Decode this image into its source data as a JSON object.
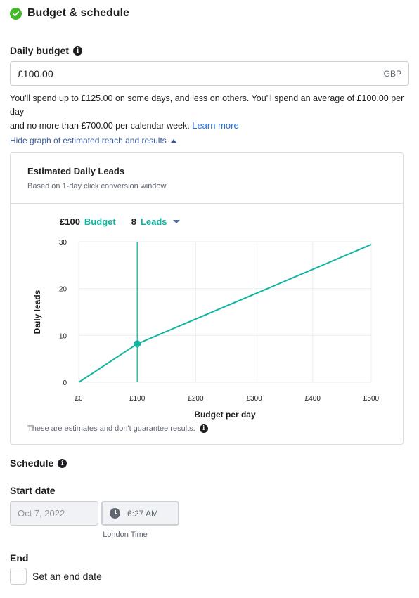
{
  "section": {
    "title": "Budget & schedule"
  },
  "budget": {
    "label": "Daily budget",
    "value": "£100.00",
    "currency": "GBP",
    "help_line1": "You'll spend up to £125.00 on some days, and less on others. You'll spend an average of £100.00 per day",
    "help_line2": "and no more than £700.00 per calendar week.",
    "learn_more": "Learn more"
  },
  "graph_toggle": {
    "label": "Hide graph of estimated reach and results"
  },
  "graph": {
    "title": "Estimated Daily Leads",
    "subtitle": "Based on 1-day click conversion window",
    "budget_stat": "£100",
    "budget_label": "Budget",
    "leads_stat": "8",
    "leads_label": "Leads",
    "disclaimer": "These are estimates and don't guarantee results."
  },
  "chart_data": {
    "type": "line",
    "xlabel": "Budget per day",
    "ylabel": "Daily leads",
    "x_ticks": [
      "£0",
      "£100",
      "£200",
      "£300",
      "£400",
      "£500"
    ],
    "y_ticks": [
      "0",
      "10",
      "20",
      "30"
    ],
    "xlim": [
      0,
      500
    ],
    "ylim": [
      0,
      30
    ],
    "x": [
      0,
      100,
      500
    ],
    "y": [
      0,
      8.2,
      29.4
    ],
    "marker": {
      "x": 100,
      "y": 8.2
    },
    "line_color": "#12b5a0",
    "grid": true
  },
  "schedule": {
    "label": "Schedule",
    "start_label": "Start date",
    "start_date": "Oct 7, 2022",
    "start_time": "6:27 AM",
    "timezone": "London Time",
    "end_label": "End",
    "end_checkbox_label": "Set an end date"
  },
  "colors": {
    "accent": "#12b5a0",
    "link": "#216fdb",
    "success": "#42b72a"
  }
}
